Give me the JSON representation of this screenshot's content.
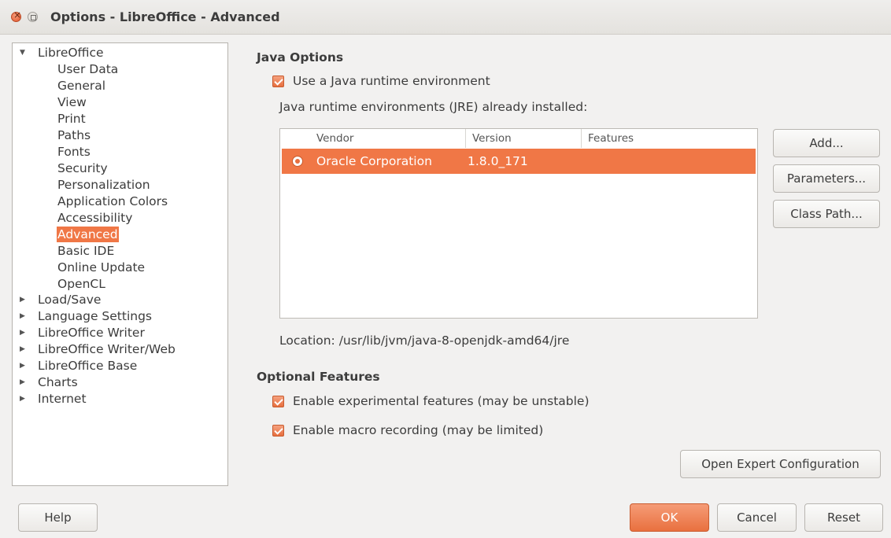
{
  "window": {
    "title": "Options - LibreOffice - Advanced"
  },
  "tree": {
    "root": "LibreOffice",
    "children": [
      "User Data",
      "General",
      "View",
      "Print",
      "Paths",
      "Fonts",
      "Security",
      "Personalization",
      "Application Colors",
      "Accessibility",
      "Advanced",
      "Basic IDE",
      "Online Update",
      "OpenCL"
    ],
    "selected": "Advanced",
    "groups": [
      "Load/Save",
      "Language Settings",
      "LibreOffice Writer",
      "LibreOffice Writer/Web",
      "LibreOffice Base",
      "Charts",
      "Internet"
    ]
  },
  "java": {
    "section_title": "Java Options",
    "use_jre_label": "Use a Java runtime environment",
    "use_jre_checked": true,
    "installed_label": "Java runtime environments (JRE) already installed:",
    "columns": [
      "Vendor",
      "Version",
      "Features"
    ],
    "rows": [
      {
        "vendor": "Oracle Corporation",
        "version": "1.8.0_171",
        "features": "",
        "selected": true
      }
    ],
    "location": "Location: /usr/lib/jvm/java-8-openjdk-amd64/jre",
    "buttons": {
      "add": "Add...",
      "parameters": "Parameters...",
      "class_path": "Class Path..."
    }
  },
  "optional": {
    "section_title": "Optional Features",
    "experimental_label": "Enable experimental features (may be unstable)",
    "experimental_checked": true,
    "macro_label": "Enable macro recording (may be limited)",
    "macro_checked": true,
    "expert_button": "Open Expert Configuration"
  },
  "footer": {
    "help": "Help",
    "ok": "OK",
    "cancel": "Cancel",
    "reset": "Reset"
  },
  "colors": {
    "accent": "#f07746",
    "window_bg": "#f2f1f0"
  }
}
